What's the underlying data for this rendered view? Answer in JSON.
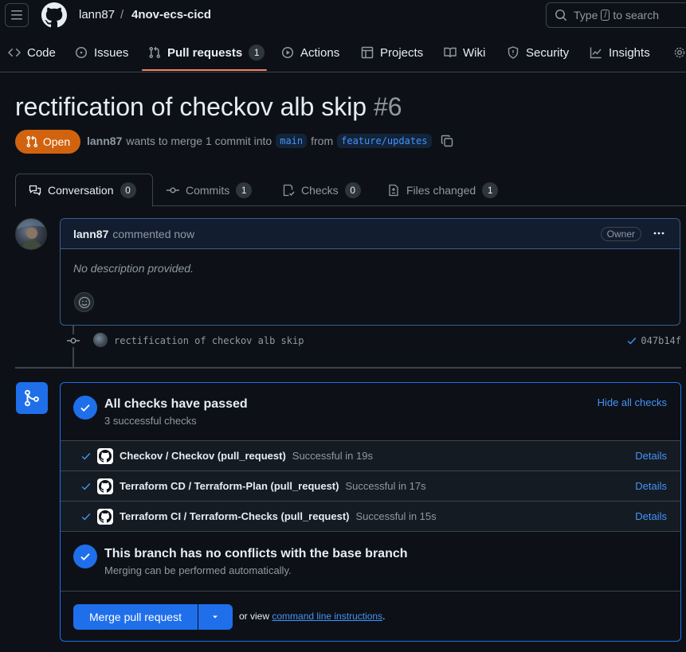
{
  "header": {
    "owner": "lann87",
    "separator": "/",
    "repo": "4nov-ecs-cicd",
    "search_prefix": "Type",
    "search_key": "/",
    "search_suffix": "to search"
  },
  "nav": {
    "code": "Code",
    "issues": "Issues",
    "pull_requests": "Pull requests",
    "pull_requests_count": "1",
    "actions": "Actions",
    "projects": "Projects",
    "wiki": "Wiki",
    "security": "Security",
    "insights": "Insights"
  },
  "pr": {
    "title": "rectification of checkov alb skip",
    "number": "#6",
    "state": "Open",
    "author": "lann87",
    "merge_text": "wants to merge 1 commit into",
    "base_branch": "main",
    "from_text": "from",
    "head_branch": "feature/updates"
  },
  "tabs": {
    "conversation": "Conversation",
    "conversation_count": "0",
    "commits": "Commits",
    "commits_count": "1",
    "checks": "Checks",
    "checks_count": "0",
    "files": "Files changed",
    "files_count": "1"
  },
  "comment": {
    "author": "lann87",
    "action": "commented now",
    "role": "Owner",
    "body": "No description provided."
  },
  "commit": {
    "message": "rectification of checkov alb skip",
    "sha": "047b14f"
  },
  "merge_box": {
    "checks_title": "All checks have passed",
    "checks_sub": "3 successful checks",
    "hide_checks": "Hide all checks",
    "checks": [
      {
        "name": "Checkov / Checkov (pull_request)",
        "status": "Successful in 19s",
        "details": "Details"
      },
      {
        "name": "Terraform CD / Terraform-Plan (pull_request)",
        "status": "Successful in 17s",
        "details": "Details"
      },
      {
        "name": "Terraform CI / Terraform-Checks (pull_request)",
        "status": "Successful in 15s",
        "details": "Details"
      }
    ],
    "conflicts_title": "This branch has no conflicts with the base branch",
    "conflicts_sub": "Merging can be performed automatically.",
    "merge_button": "Merge pull request",
    "or_view": "or view",
    "cli_link": "command line instructions",
    "period": "."
  },
  "colors": {
    "accent": "#1f6feb",
    "open_badge": "#d1630f",
    "nav_underline": "#f78166",
    "link": "#4493f8"
  }
}
